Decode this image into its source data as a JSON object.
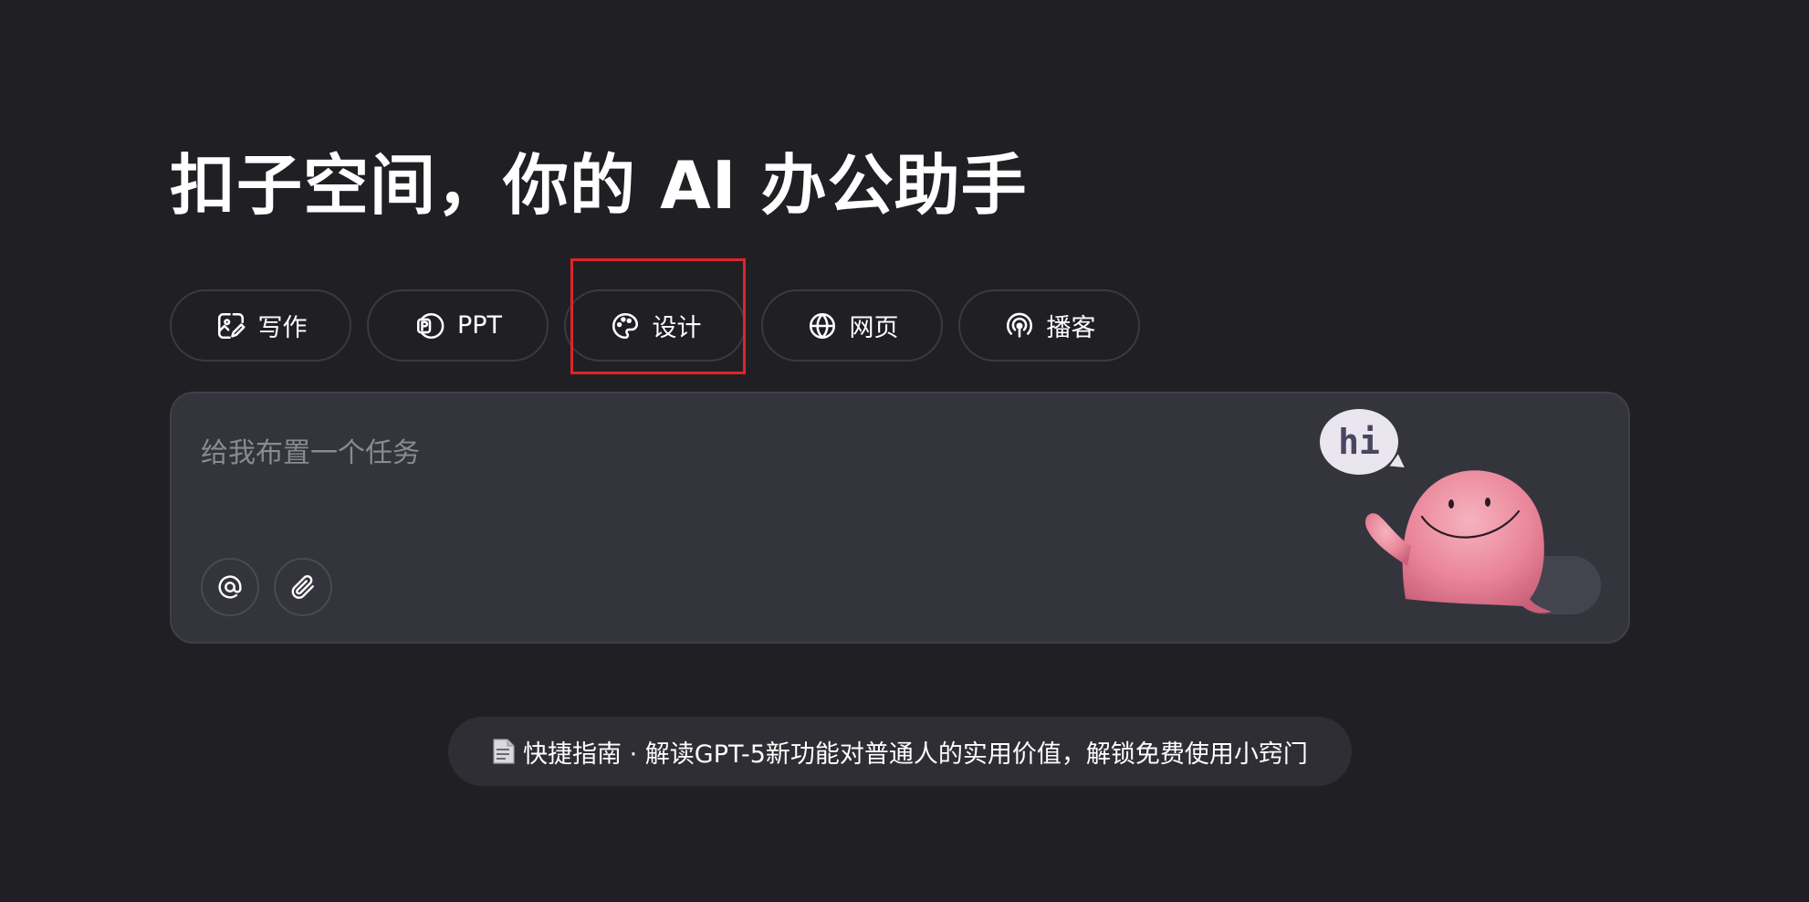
{
  "header": {
    "title": "扣子空间，你的 AI 办公助手"
  },
  "tabs": [
    {
      "label": "写作",
      "icon": "image-edit-icon"
    },
    {
      "label": "PPT",
      "icon": "ppt-icon"
    },
    {
      "label": "设计",
      "icon": "palette-icon"
    },
    {
      "label": "网页",
      "icon": "globe-icon"
    },
    {
      "label": "播客",
      "icon": "podcast-icon"
    }
  ],
  "input": {
    "placeholder": "给我布置一个任务",
    "mention_icon": "at-icon",
    "attach_icon": "paperclip-icon",
    "send_icon": "send-icon"
  },
  "mascot": {
    "bubble_text": "hi"
  },
  "guide": {
    "text": "快捷指南 · 解读GPT-5新功能对普通人的实用价值，解锁免费使用小窍门",
    "icon": "document-icon"
  },
  "colors": {
    "background": "#202024",
    "card": "#34343c",
    "highlight": "#e0242b",
    "mascot_pink": "#e98598"
  }
}
